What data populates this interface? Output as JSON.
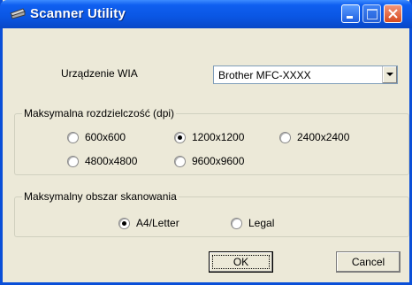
{
  "window": {
    "title": "Scanner Utility"
  },
  "device": {
    "label": "Urządzenie WIA",
    "value": "Brother MFC-XXXX"
  },
  "resolution": {
    "legend": "Maksymalna rozdzielczość (dpi)",
    "options": [
      "600x600",
      "1200x1200",
      "2400x2400",
      "4800x4800",
      "9600x9600"
    ],
    "selected": "1200x1200"
  },
  "scan_area": {
    "legend": "Maksymalny obszar skanowania",
    "options": [
      "A4/Letter",
      "Legal"
    ],
    "selected": "A4/Letter"
  },
  "buttons": {
    "ok": "OK",
    "cancel": "Cancel"
  },
  "colors": {
    "titlebar": "#0a56e3",
    "dialog_bg": "#ece9d8"
  }
}
